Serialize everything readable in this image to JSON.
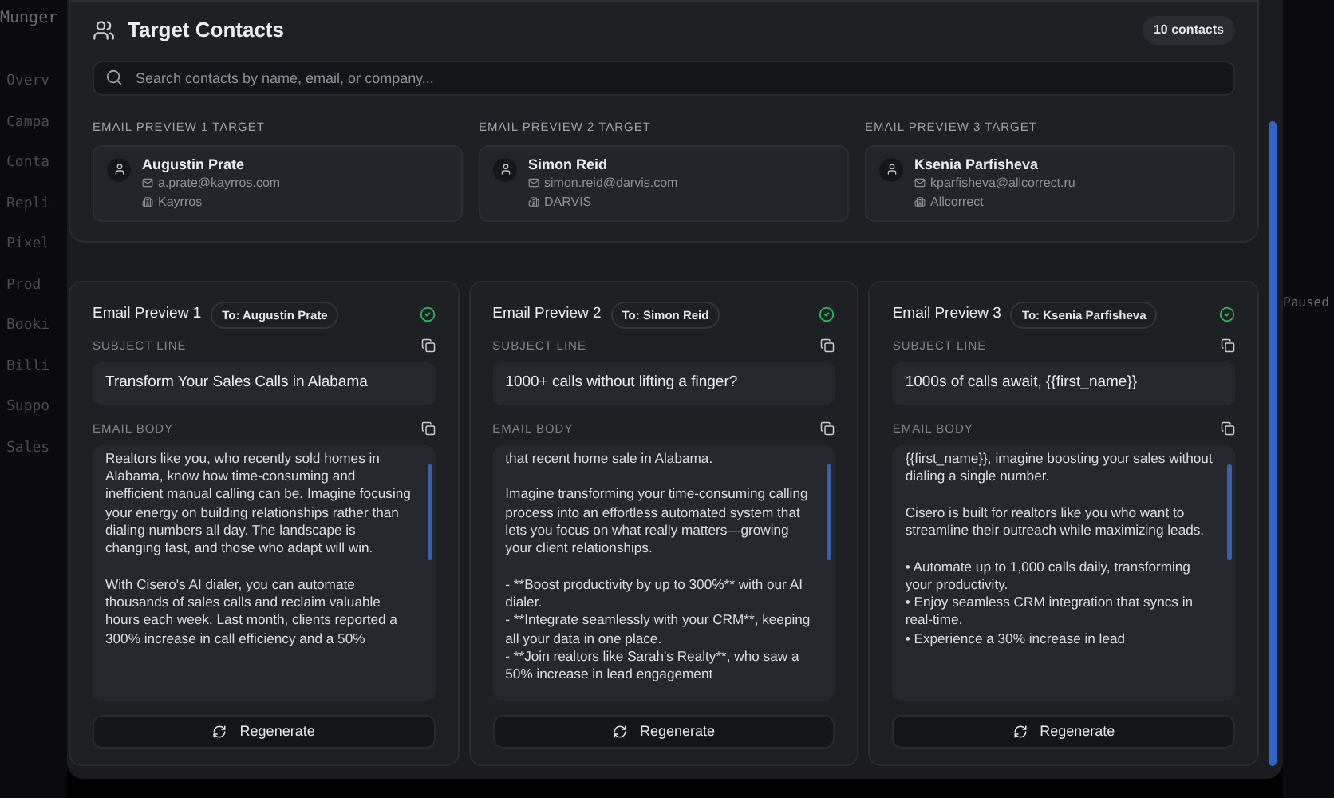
{
  "background": {
    "app_title": "Munger",
    "sidebar_items": [
      "Overv",
      "Campa",
      "Conta",
      "Repli",
      "Pixel",
      "Prod",
      "Booki",
      "Billi",
      "Suppo",
      "Sales"
    ],
    "status": "Paused"
  },
  "contacts": {
    "title": "Target Contacts",
    "count": "10 contacts",
    "search": {
      "placeholder": "Search contacts by name, email, or company..."
    },
    "targets": [
      {
        "label": "EMAIL PREVIEW 1 TARGET",
        "name": "Augustin Prate",
        "email": "a.prate@kayrros.com",
        "company": "Kayrros"
      },
      {
        "label": "EMAIL PREVIEW 2 TARGET",
        "name": "Simon Reid",
        "email": "simon.reid@darvis.com",
        "company": "DARVIS"
      },
      {
        "label": "EMAIL PREVIEW 3 TARGET",
        "name": "Ksenia Parfisheva",
        "email": "kparfisheva@allcorrect.ru",
        "company": "Allcorrect"
      }
    ]
  },
  "previews": [
    {
      "title": "Email Preview 1",
      "to": "To: Augustin Prate",
      "verified": true,
      "subject_label": "SUBJECT LINE",
      "subject": "Transform Your Sales Calls in Alabama",
      "body_label": "EMAIL BODY",
      "body": "Realtors like you, who recently sold homes in Alabama, know how time-consuming and inefficient manual calling can be. Imagine focusing your energy on building relationships rather than dialing numbers all day. The landscape is changing fast, and those who adapt will win.\n\nWith Cisero's AI dialer, you can automate thousands of sales calls and reclaim valuable hours each week. Last month, clients reported a 300% increase in call efficiency and a 50%",
      "button": "Regenerate"
    },
    {
      "title": "Email Preview 2",
      "to": "To: Simon Reid",
      "verified": true,
      "subject_label": "SUBJECT LINE",
      "subject": "1000+ calls without lifting a finger?",
      "body_label": "EMAIL BODY",
      "body": "that recent home sale in Alabama.\n\nImagine transforming your time-consuming calling process into an effortless automated system that lets you focus on what really matters—growing your client relationships.\n\n- **Boost productivity by up to 300%** with our AI dialer.\n- **Integrate seamlessly with your CRM**, keeping all your data in one place.\n- **Join realtors like Sarah's Realty**, who saw a 50% increase in lead engagement",
      "button": "Regenerate"
    },
    {
      "title": "Email Preview 3",
      "to": "To: Ksenia Parfisheva",
      "verified": true,
      "subject_label": "SUBJECT LINE",
      "subject": "1000s of calls await, {{first_name}}",
      "body_label": "EMAIL BODY",
      "body": "{{first_name}}, imagine boosting your sales without dialing a single number.\n\nCisero is built for realtors like you who want to streamline their outreach while maximizing leads.\n\n• Automate up to 1,000 calls daily, transforming your productivity.\n• Enjoy seamless CRM integration that syncs in real-time.\n• Experience a 30% increase in lead",
      "button": "Regenerate"
    }
  ]
}
